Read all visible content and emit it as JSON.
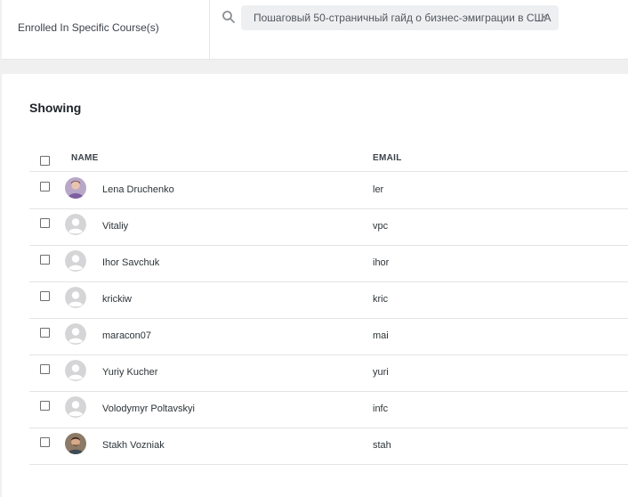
{
  "filter": {
    "label": "Enrolled In Specific Course(s)",
    "chip_text": "Пошаговый 50-страничный гайд о бизнес-эмиграции в США",
    "chip_close": "×"
  },
  "table": {
    "heading": "Showing",
    "columns": {
      "name": "NAME",
      "email": "EMAIL"
    },
    "rows": [
      {
        "name": "Lena Druchenko",
        "email": "ler",
        "avatar": "photo-female"
      },
      {
        "name": "Vitaliy",
        "email": "vpc",
        "avatar": "default"
      },
      {
        "name": "Ihor Savchuk",
        "email": "ihor",
        "avatar": "default"
      },
      {
        "name": "krickiw",
        "email": "kric",
        "avatar": "default"
      },
      {
        "name": "maracon07",
        "email": "mai",
        "avatar": "default"
      },
      {
        "name": "Yuriy Kucher",
        "email": "yuri",
        "avatar": "default"
      },
      {
        "name": "Volodymyr Poltavskyi",
        "email": "infc",
        "avatar": "default"
      },
      {
        "name": "Stakh Vozniak",
        "email": "stah",
        "avatar": "photo-male"
      }
    ]
  },
  "icons": {
    "search": "search-icon",
    "close": "close-icon",
    "avatar_default": "avatar-placeholder-icon"
  },
  "colors": {
    "page_bg": "#f0f0f1",
    "panel_bg": "#ffffff",
    "chip_bg": "#eeeff1",
    "avatar_placeholder": "#d5d5d7"
  }
}
